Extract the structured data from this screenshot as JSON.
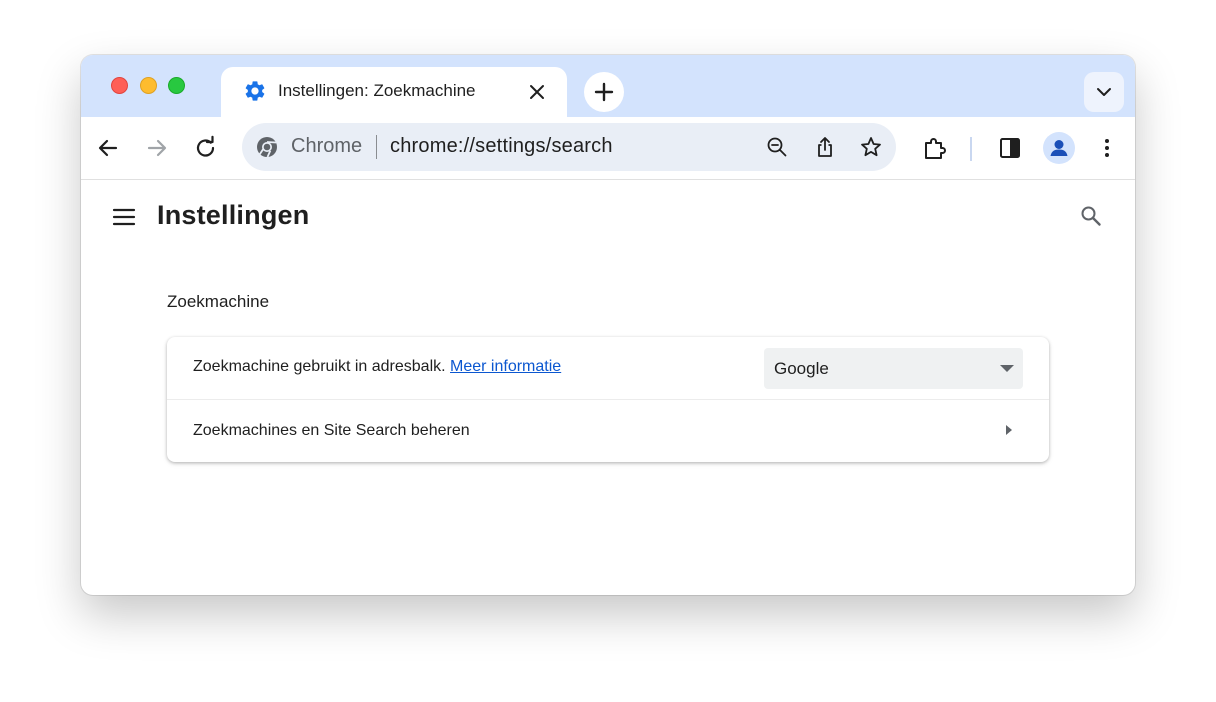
{
  "window": {
    "traffic_lights": [
      "close",
      "minimize",
      "zoom"
    ]
  },
  "tabs": [
    {
      "title": "Instellingen: Zoekmachine",
      "icon": "gear-icon",
      "active": true
    }
  ],
  "toolbar": {
    "back_icon": "arrow-back-icon",
    "forward_icon": "arrow-forward-icon",
    "reload_icon": "reload-icon",
    "omnibox": {
      "chip_label": "Chrome",
      "url": "chrome://settings/search",
      "actions": [
        "zoom-out-icon",
        "share-icon",
        "star-icon"
      ]
    },
    "extensions_icon": "puzzle-icon",
    "side_panel_icon": "side-panel-icon",
    "profile_icon": "person-icon",
    "menu_icon": "more-vertical-icon"
  },
  "settings": {
    "page_title": "Instellingen",
    "section_title": "Zoekmachine",
    "rows": {
      "engine_label": "Zoekmachine gebruikt in adresbalk.",
      "engine_link": "Meer informatie",
      "engine_selected": "Google",
      "manage_label": "Zoekmachines en Site Search beheren"
    }
  },
  "colors": {
    "tabstrip_bg": "#d3e3fd",
    "omnibox_bg": "#e9eef6",
    "link": "#0b57d0",
    "accent_blue": "#1a73e8"
  }
}
